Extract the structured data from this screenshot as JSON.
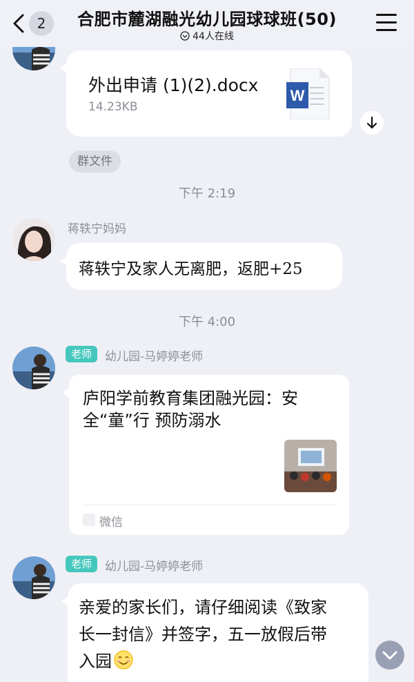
{
  "header": {
    "unread_count": "2",
    "title": "合肥市麓湖融光幼儿园球球班(50)",
    "online": "44人在线"
  },
  "messages": {
    "file": {
      "name": "外出申请 (1)(2).docx",
      "size": "14.23KB",
      "group_file_label": "群文件"
    },
    "time1": "下午 2:19",
    "msg2": {
      "sender": "蒋轶宁妈妈",
      "text": "蒋轶宁及家人无离肥，返肥+25"
    },
    "time2": "下午 4:00",
    "share": {
      "role_badge": "老师",
      "sender": "幼儿园-马婷婷老师",
      "title": "庐阳学前教育集团融光园：安全“童”行 预防溺水",
      "source": "微信"
    },
    "msg4": {
      "role_badge": "老师",
      "sender": "幼儿园-马婷婷老师",
      "text_line1": "亲爱的家长们，请仔细阅读《致家",
      "text_line2": "长一封信》并签字，五一放假后带",
      "text_line3": "入园"
    }
  },
  "colors": {
    "background": "#eef0f6",
    "bubble": "#ffffff",
    "teacher_badge": "#45c7bd",
    "word_icon": "#2e5aab"
  }
}
